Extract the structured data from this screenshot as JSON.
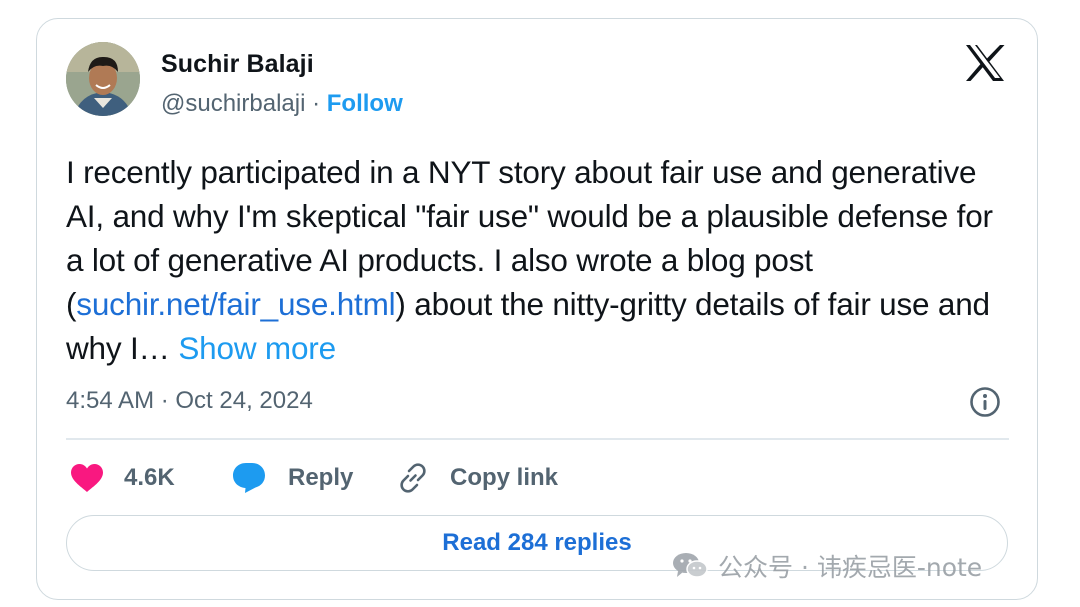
{
  "author": {
    "name": "Suchir Balaji",
    "handle": "@suchirbalaji",
    "separator": " · ",
    "follow_label": "Follow"
  },
  "tweet": {
    "text_part1": "I recently participated in a NYT story about fair use and generative AI, and why I'm skeptical \"fair use\" would be a plausible defense for a lot of generative AI products. I also wrote a blog post (",
    "link_text": "suchir.net/fair_use.html",
    "text_part2": ") about the nitty-gritty details of fair use and why I… ",
    "show_more_label": "Show more",
    "timestamp": "4:54 AM · Oct 24, 2024"
  },
  "actions": {
    "like_count": "4.6K",
    "reply_label": "Reply",
    "copy_link_label": "Copy link"
  },
  "read_replies_label": "Read 284 replies",
  "watermark": {
    "text": "公众号 · 讳疾忌医-note"
  },
  "icons": {
    "logo": "x-logo-icon",
    "like": "heart-icon",
    "reply": "speech-bubble-icon",
    "copy": "link-icon",
    "info": "info-icon"
  },
  "colors": {
    "accent": "#1d9bf0",
    "link": "#1d6fd6",
    "heart": "#f91880",
    "muted": "#536471",
    "border": "#cfd9de"
  }
}
